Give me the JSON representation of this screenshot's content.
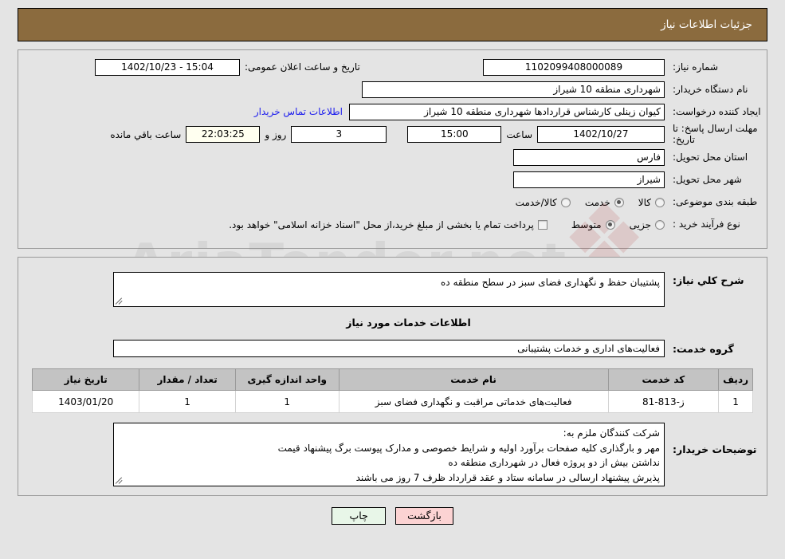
{
  "header": {
    "title": "جزئیات اطلاعات نیاز",
    "bar_color": "#8b6b3e"
  },
  "top_form": {
    "need_number": {
      "label": "شماره نیاز:",
      "value": "1102099408000089"
    },
    "announce": {
      "label": "تاریخ و ساعت اعلان عمومی:",
      "value": "15:04 - 1402/10/23"
    },
    "buyer_org": {
      "label": "نام دستگاه خریدار:",
      "value": "شهرداری منطقه 10 شیراز"
    },
    "creator": {
      "label": "ایجاد کننده درخواست:",
      "value": "کیوان زینلی کارشناس قراردادها شهرداری منطقه 10 شیراز"
    },
    "contact_link": "اطلاعات تماس خریدار",
    "deadline": {
      "label": "مهلت ارسال پاسخ: تا تاریخ:",
      "date": "1402/10/27",
      "time_label": "ساعت",
      "time": "15:00",
      "days": "3",
      "days_label": "روز و",
      "countdown": "22:03:25",
      "remaining_label": "ساعت باقي مانده"
    },
    "province": {
      "label": "استان محل تحویل:",
      "value": "فارس"
    },
    "city": {
      "label": "شهر محل تحویل:",
      "value": "شیراز"
    },
    "category": {
      "label": "طبقه بندی موضوعی:",
      "options": [
        "کالا",
        "خدمت",
        "کالا/خدمت"
      ],
      "selected": "خدمت"
    },
    "purchase_type": {
      "label": "نوع فرآیند خرید :",
      "options": [
        "جزیی",
        "متوسط"
      ],
      "selected": "متوسط",
      "checkbox_note": "پرداخت تمام یا بخشی از مبلغ خرید،از محل \"اسناد خزانه اسلامی\" خواهد بود.",
      "checkbox_checked": false
    }
  },
  "middle": {
    "general_desc": {
      "label": "شرح کلي نياز:",
      "value": "پشتیبان حفظ و نگهداری فضای سبز در سطح منطقه ده"
    },
    "services_title": "اطلاعات خدمات مورد نیاز",
    "service_group": {
      "label": "گروه خدمت:",
      "value": "فعالیت‌های اداری و خدمات پشتیبانی"
    },
    "table": {
      "columns": [
        "ردیف",
        "کد خدمت",
        "نام خدمت",
        "واحد اندازه گیری",
        "تعداد / مقدار",
        "تاریخ نیاز"
      ],
      "rows": [
        {
          "radif": "1",
          "code": "ز-813-81",
          "name": "فعالیت‌های خدماتی مراقبت و نگهداری فضای سبز",
          "unit": "1",
          "qty": "1",
          "date": "1403/01/20"
        }
      ]
    },
    "buyer_notes": {
      "label": "توضیحات خریدار:",
      "lines": [
        "شرکت کنندگان ملزم به:",
        "مهر و بارگذاری کلیه صفحات برآورد اولیه و شرایط خصوصی و مدارک پیوست برگ پیشنهاد قیمت",
        "نداشتن بیش از دو پروژه فعال در شهرداری منطقه ده",
        "پذیرش پیشنهاد ارسالی در سامانه ستاد و عقد قرارداد ظرف 7 روز می باشند"
      ]
    }
  },
  "footer": {
    "print_label": "چاپ",
    "back_label": "بازگشت"
  },
  "watermark": {
    "text": "AriaTender.net",
    "shield_glyph": "❖"
  }
}
